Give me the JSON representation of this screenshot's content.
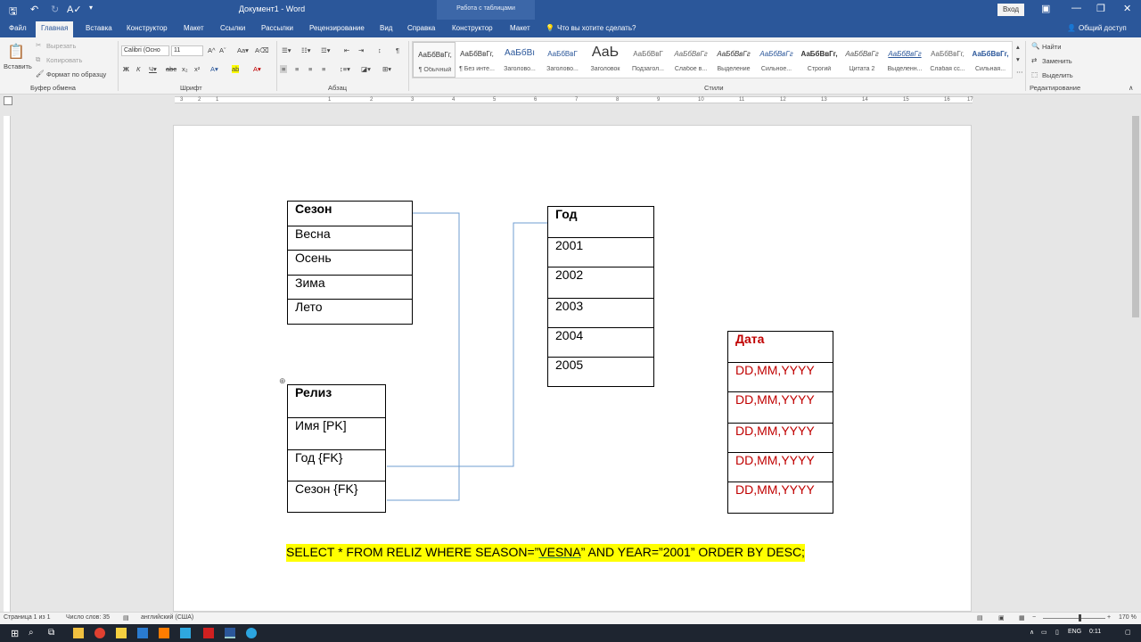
{
  "window": {
    "title": "Документ1 - Word",
    "context_tab_group": "Работа с таблицами",
    "signin": "Вход"
  },
  "tabs": [
    "Файл",
    "Главная",
    "Вставка",
    "Конструктор",
    "Макет",
    "Ссылки",
    "Рассылки",
    "Рецензирование",
    "Вид",
    "Справка",
    "Конструктор",
    "Макет"
  ],
  "tell_me": "Что вы хотите сделать?",
  "share": "Общий доступ",
  "clipboard": {
    "paste": "Вставить",
    "cut": "Вырезать",
    "copy": "Копировать",
    "format_painter": "Формат по образцу",
    "group": "Буфер обмена"
  },
  "font": {
    "name": "Calibri (Осно",
    "size": "11",
    "group": "Шрифт"
  },
  "paragraph": {
    "group": "Абзац"
  },
  "styles": {
    "group": "Стили",
    "items": [
      {
        "sample": "АаБбВвГг,",
        "name": "¶ Обычный"
      },
      {
        "sample": "АаБбВвГг,",
        "name": "¶ Без инте..."
      },
      {
        "sample": "АаБбВı",
        "name": "Заголово..."
      },
      {
        "sample": "АаБбВвГ",
        "name": "Заголово..."
      },
      {
        "sample": "АаЬ",
        "name": "Заголовок"
      },
      {
        "sample": "АаБбВвГ",
        "name": "Подзагол..."
      },
      {
        "sample": "АаБбВвГг",
        "name": "Слабое в..."
      },
      {
        "sample": "АаБбВвГг",
        "name": "Выделение"
      },
      {
        "sample": "АаБбВвГг",
        "name": "Сильное..."
      },
      {
        "sample": "АаБбВвГг,",
        "name": "Строгий"
      },
      {
        "sample": "АаБбВвГг",
        "name": "Цитата 2"
      },
      {
        "sample": "АаБбВвГг",
        "name": "Выделенн..."
      },
      {
        "sample": "АаБбВвГг,",
        "name": "Слабая сс..."
      },
      {
        "sample": "АаБбВвГг,",
        "name": "Сильная..."
      }
    ]
  },
  "editing": {
    "find": "Найти",
    "replace": "Заменить",
    "select": "Выделить",
    "group": "Редактирование"
  },
  "ruler_ticks": [
    "3",
    "2",
    "1",
    "1",
    "2",
    "3",
    "4",
    "5",
    "6",
    "7",
    "8",
    "9",
    "10",
    "11",
    "12",
    "13",
    "14",
    "15",
    "16",
    "17"
  ],
  "tables": {
    "season": {
      "header": "Сезон",
      "rows": [
        "Весна",
        "Осень",
        "Зима",
        "Лето"
      ]
    },
    "year": {
      "header": "Год",
      "rows": [
        "2001",
        "2002",
        "2003",
        "2004",
        "2005"
      ]
    },
    "release": {
      "header": "Релиз",
      "rows": [
        "Имя [PK]",
        "Год {FK}",
        "Сезон {FK}"
      ]
    },
    "date": {
      "header": "Дата",
      "rows": [
        "DD,MM,YYYY",
        "DD,MM,YYYY",
        "DD,MM,YYYY",
        "DD,MM,YYYY",
        "DD,MM,YYYY"
      ]
    }
  },
  "query": {
    "before": "SELECT * FROM RELIZ WHERE SEASON=”",
    "underlined": "VESNA",
    "after": "” AND YEAR=”2001” ORDER BY DESC;"
  },
  "statusbar": {
    "page": "Страница 1 из 1",
    "words": "Число слов: 35",
    "language": "английский (США)",
    "zoom": "170 %"
  },
  "taskbar": {
    "lang": "ENG",
    "time": "0:11"
  },
  "colors": {
    "accent": "#2b579a",
    "header_red": "#c00000",
    "highlight": "#ffff00"
  }
}
